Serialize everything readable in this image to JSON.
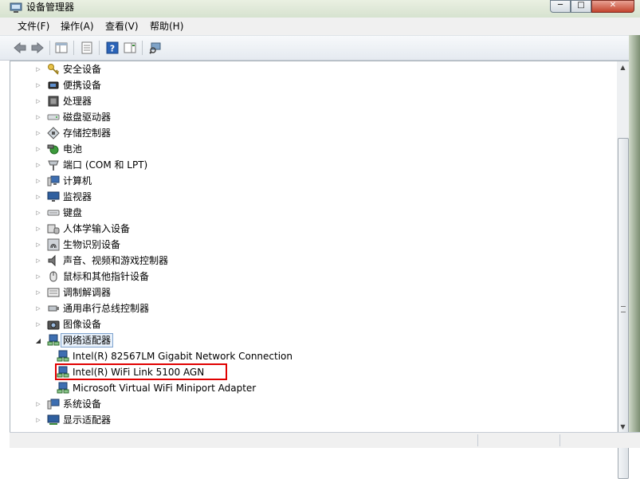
{
  "window": {
    "title": "设备管理器"
  },
  "window_controls": {
    "minimize": "─",
    "maximize": "□",
    "close": "✕"
  },
  "menu": {
    "items": [
      {
        "label": "文件(F)"
      },
      {
        "label": "操作(A)"
      },
      {
        "label": "查看(V)"
      },
      {
        "label": "帮助(H)"
      }
    ]
  },
  "toolbar": {
    "buttons": [
      {
        "icon": "back-arrow-icon"
      },
      {
        "icon": "forward-arrow-icon"
      },
      {
        "icon": "show-hide-tree-icon"
      },
      {
        "icon": "properties-icon"
      },
      {
        "icon": "help-icon"
      },
      {
        "icon": "action-pane-icon"
      },
      {
        "icon": "scan-hardware-icon"
      }
    ]
  },
  "tree": {
    "categories": [
      {
        "label": "安全设备",
        "icon": "key-icon"
      },
      {
        "label": "便携设备",
        "icon": "portable-device-icon"
      },
      {
        "label": "处理器",
        "icon": "processor-icon"
      },
      {
        "label": "磁盘驱动器",
        "icon": "disk-drive-icon"
      },
      {
        "label": "存储控制器",
        "icon": "storage-controller-icon"
      },
      {
        "label": "电池",
        "icon": "battery-icon"
      },
      {
        "label": "端口 (COM 和 LPT)",
        "icon": "port-icon"
      },
      {
        "label": "计算机",
        "icon": "computer-icon"
      },
      {
        "label": "监视器",
        "icon": "monitor-icon"
      },
      {
        "label": "键盘",
        "icon": "keyboard-icon"
      },
      {
        "label": "人体学输入设备",
        "icon": "hid-icon"
      },
      {
        "label": "生物识别设备",
        "icon": "fingerprint-icon"
      },
      {
        "label": "声音、视频和游戏控制器",
        "icon": "speaker-icon"
      },
      {
        "label": "鼠标和其他指针设备",
        "icon": "mouse-icon"
      },
      {
        "label": "调制解调器",
        "icon": "modem-icon"
      },
      {
        "label": "通用串行总线控制器",
        "icon": "usb-icon"
      },
      {
        "label": "图像设备",
        "icon": "camera-icon"
      },
      {
        "label": "网络适配器",
        "icon": "network-adapter-icon",
        "expanded": true
      },
      {
        "label": "系统设备",
        "icon": "system-device-icon"
      },
      {
        "label": "显示适配器",
        "icon": "display-adapter-icon"
      }
    ],
    "network_adapters": [
      {
        "label": "Intel(R) 82567LM Gigabit Network Connection"
      },
      {
        "label": "Intel(R) WiFi Link 5100 AGN",
        "highlighted": true
      },
      {
        "label": "Microsoft Virtual WiFi Miniport Adapter"
      }
    ]
  },
  "colors": {
    "highlight_border": "#e00000",
    "selection_bg": "#e8f1fb",
    "selection_border": "#7da2ce"
  }
}
